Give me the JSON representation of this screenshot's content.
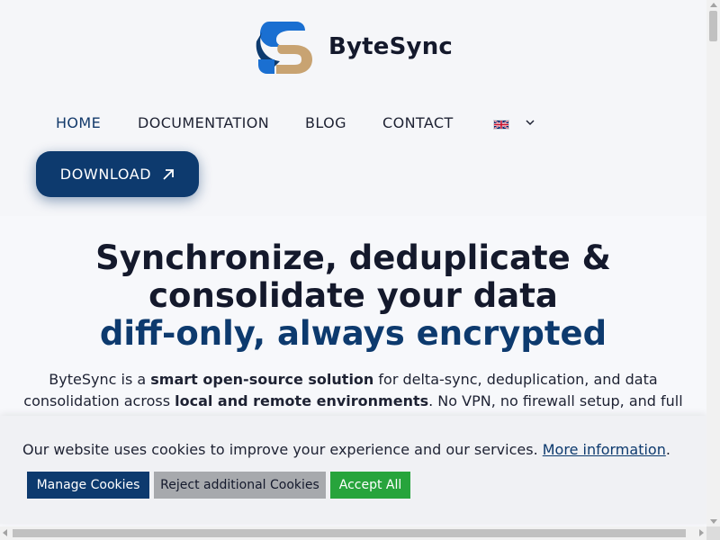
{
  "brand": {
    "name": "ByteSync"
  },
  "nav": {
    "items": [
      {
        "label": "HOME",
        "active": true
      },
      {
        "label": "DOCUMENTATION",
        "active": false
      },
      {
        "label": "BLOG",
        "active": false
      },
      {
        "label": "CONTACT",
        "active": false
      }
    ],
    "language_icon": "uk-flag-icon",
    "language_dropdown_icon": "chevron-down-icon"
  },
  "download": {
    "label": "DOWNLOAD",
    "icon": "arrow-up-right-icon"
  },
  "hero": {
    "title_line1": "Synchronize, deduplicate &",
    "title_line2": "consolidate your data",
    "title_accent": "diff-only, always encrypted",
    "desc_1": "ByteSync is a ",
    "desc_bold_1": "smart open-source solution",
    "desc_2": " for delta-sync, deduplication, and data consolidation across ",
    "desc_bold_2": "local and remote environments",
    "desc_3": ". No VPN, no firewall setup, and full end-to-end encryption."
  },
  "cookies": {
    "message": "Our website uses cookies to improve your experience and our services.",
    "link_label": "More information",
    "period": ".",
    "manage_label": "Manage Cookies",
    "reject_label": "Reject additional Cookies",
    "accept_label": "Accept All"
  },
  "colors": {
    "accent": "#0d3a6e",
    "accept": "#27a43c",
    "reject": "#a7a9ad",
    "logo_blue": "#1a6fd1",
    "logo_tan": "#c8a372"
  }
}
